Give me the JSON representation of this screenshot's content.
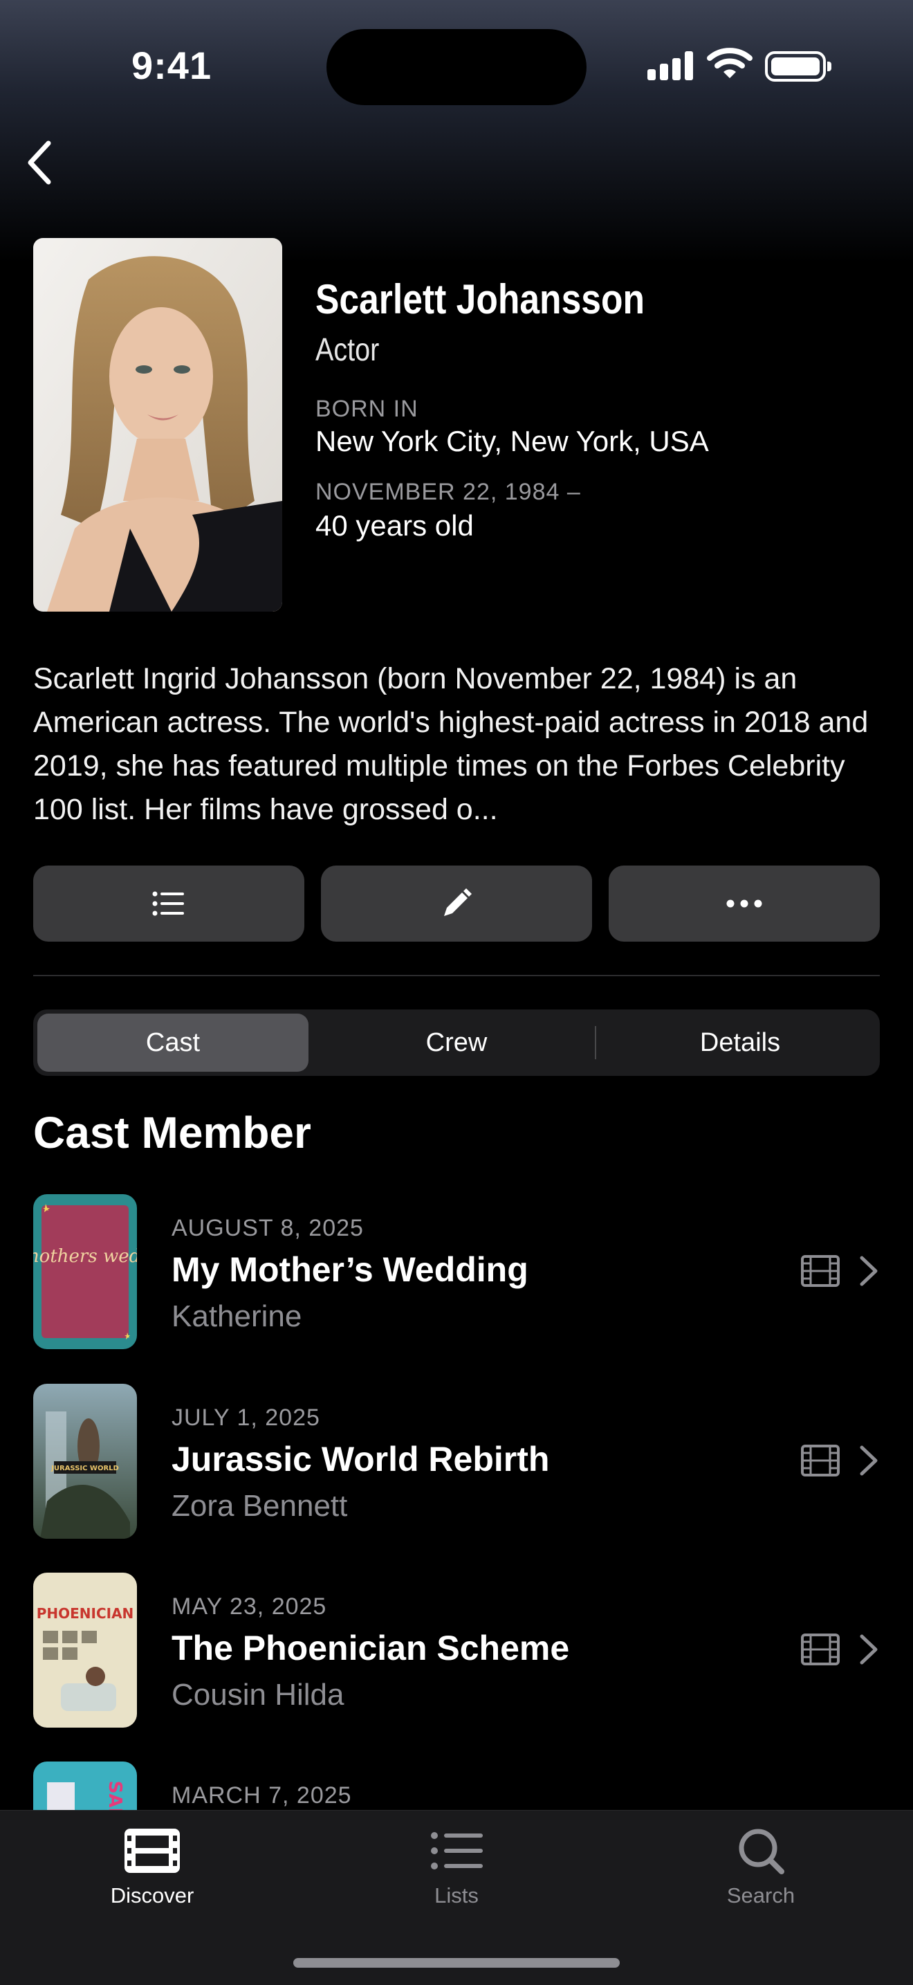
{
  "status_bar": {
    "time": "9:41"
  },
  "person": {
    "name": "Scarlett Johansson",
    "role": "Actor",
    "born_label": "BORN IN",
    "born_place": "New York City, New York, USA",
    "birth_date_label": "NOVEMBER 22, 1984 –",
    "age": "40 years old",
    "bio": "Scarlett Ingrid Johansson (born November 22, 1984) is an American actress. The world's highest-paid actress in 2018 and 2019, she has featured multiple times on the Forbes Celebrity 100 list. Her films have grossed o..."
  },
  "actions": [
    "list-icon",
    "pencil-icon",
    "more-icon"
  ],
  "segments": [
    {
      "label": "Cast",
      "active": true
    },
    {
      "label": "Crew",
      "active": false
    },
    {
      "label": "Details",
      "active": false
    }
  ],
  "section_title": "Cast Member",
  "credits": [
    {
      "date": "AUGUST 8, 2025",
      "title": "My Mother’s Wedding",
      "character": "Katherine",
      "poster_text": "my mothers wedding"
    },
    {
      "date": "JULY 1, 2025",
      "title": "Jurassic World Rebirth",
      "character": "Zora Bennett",
      "poster_text": "JURASSIC WORLD"
    },
    {
      "date": "MAY 23, 2025",
      "title": "The Phoenician Scheme",
      "character": "Cousin Hilda",
      "poster_text": "PHOENICIAN"
    },
    {
      "date": "MARCH 7, 2025",
      "title": "",
      "character": "",
      "poster_text": "SAM"
    }
  ],
  "tabbar": {
    "tabs": [
      {
        "label": "Discover",
        "icon": "film-icon",
        "active": true
      },
      {
        "label": "Lists",
        "icon": "list-icon",
        "active": false
      },
      {
        "label": "Search",
        "icon": "search-icon",
        "active": false
      }
    ]
  },
  "colors": {
    "background": "#000000",
    "secondary_text": "#8e8e93",
    "button_fill": "#3a3a3c"
  }
}
